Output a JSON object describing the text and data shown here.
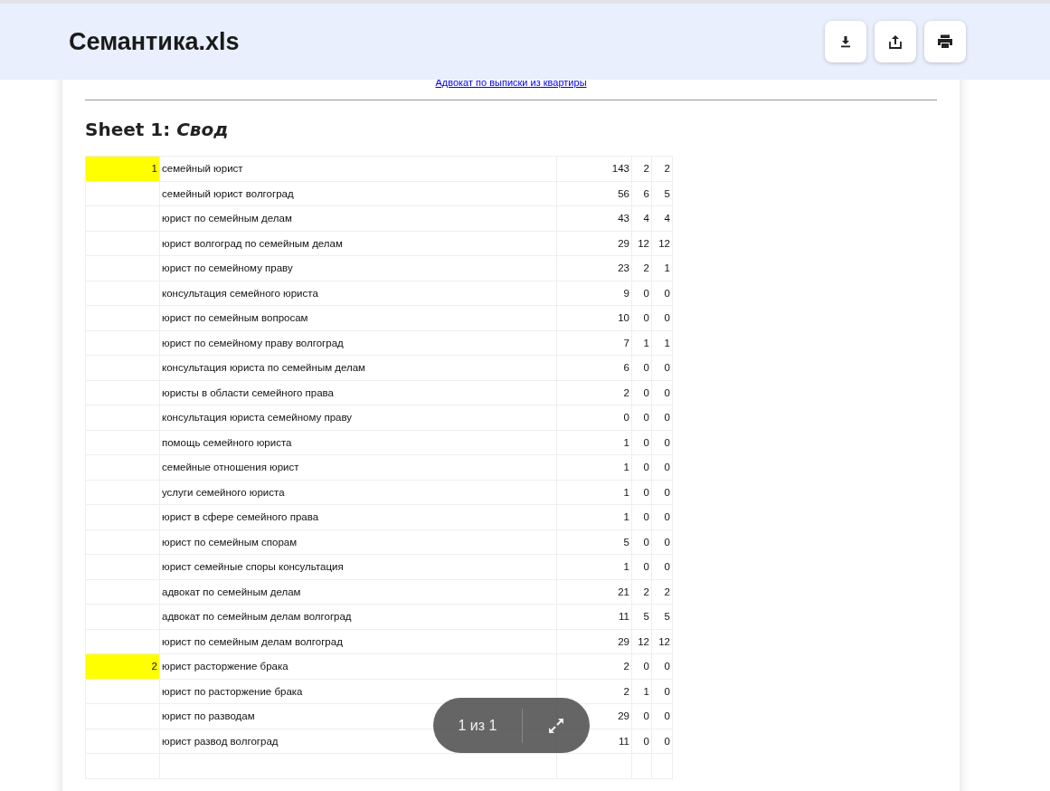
{
  "header": {
    "title": "Семантика.xls",
    "buttons": [
      {
        "kind": "download"
      },
      {
        "kind": "share"
      },
      {
        "kind": "print"
      }
    ]
  },
  "document": {
    "link": "Адвокат по выписки из квартиры",
    "sheet_title": "Sheet 1: *Свод*",
    "rows": [
      {
        "index": "1",
        "highlighted": true,
        "phrase": "семейный юрист",
        "values": [
          "143",
          "2",
          "2"
        ]
      },
      {
        "highlighted": false,
        "phrase": "семейный юрист волгоград",
        "values": [
          "56",
          "6",
          "5"
        ]
      },
      {
        "highlighted": false,
        "phrase": "юрист по семейным делам",
        "values": [
          "43",
          "4",
          "4"
        ]
      },
      {
        "highlighted": false,
        "phrase": "юрист волгоград по семейным делам",
        "values": [
          "29",
          "12",
          "12"
        ]
      },
      {
        "highlighted": false,
        "phrase": "юрист по семейному праву",
        "values": [
          "23",
          "2",
          "1"
        ]
      },
      {
        "highlighted": false,
        "phrase": "консультация семейного юриста",
        "values": [
          "9",
          "0",
          "0"
        ]
      },
      {
        "highlighted": false,
        "phrase": "юрист по семейным вопросам",
        "values": [
          "10",
          "0",
          "0"
        ]
      },
      {
        "highlighted": false,
        "phrase": "юрист по семейному праву волгоград",
        "values": [
          "7",
          "1",
          "1"
        ]
      },
      {
        "highlighted": false,
        "phrase": "консультация юриста по семейным делам",
        "values": [
          "6",
          "0",
          "0"
        ]
      },
      {
        "highlighted": false,
        "phrase": "юристы в области семейного права",
        "values": [
          "2",
          "0",
          "0"
        ]
      },
      {
        "highlighted": false,
        "phrase": "консультация юриста семейному праву",
        "values": [
          "0",
          "0",
          "0"
        ]
      },
      {
        "highlighted": false,
        "phrase": "помощь семейного юриста",
        "values": [
          "1",
          "0",
          "0"
        ]
      },
      {
        "highlighted": false,
        "phrase": "семейные отношения юрист",
        "values": [
          "1",
          "0",
          "0"
        ]
      },
      {
        "highlighted": false,
        "phrase": "услуги семейного юриста",
        "values": [
          "1",
          "0",
          "0"
        ]
      },
      {
        "highlighted": false,
        "phrase": "юрист в сфере семейного права",
        "values": [
          "1",
          "0",
          "0"
        ]
      },
      {
        "highlighted": false,
        "phrase": "юрист по семейным спорам",
        "values": [
          "5",
          "0",
          "0"
        ]
      },
      {
        "highlighted": false,
        "phrase": "юрист семейные споры консультация",
        "values": [
          "1",
          "0",
          "0"
        ]
      },
      {
        "highlighted": false,
        "phrase": "адвокат по семейным делам",
        "values": [
          "21",
          "2",
          "2"
        ]
      },
      {
        "highlighted": false,
        "phrase": "адвокат по семейным делам волгоград",
        "values": [
          "11",
          "5",
          "5"
        ]
      },
      {
        "highlighted": false,
        "phrase": "юрист по семейным делам волгоград",
        "values": [
          "29",
          "12",
          "12"
        ]
      },
      {
        "index": "2",
        "highlighted": true,
        "phrase": "юрист расторжение брака",
        "values": [
          "2",
          "0",
          "0"
        ]
      },
      {
        "highlighted": false,
        "phrase": "юрист по расторжение брака",
        "values": [
          "2",
          "1",
          "0"
        ]
      },
      {
        "highlighted": false,
        "phrase": "юрист по разводам",
        "values": [
          "29",
          "0",
          "0"
        ]
      },
      {
        "highlighted": false,
        "phrase": "юрист развод волгоград",
        "values": [
          "11",
          "0",
          "0"
        ]
      }
    ]
  },
  "pager": {
    "text": "1 из 1"
  }
}
